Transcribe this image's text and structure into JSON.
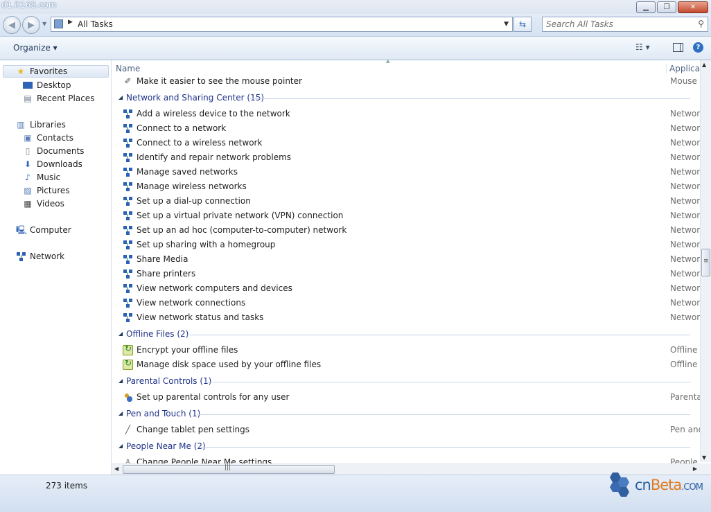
{
  "watermark": "d1.it168.com",
  "window_controls": {
    "minimize": "▁",
    "maximize": "❐",
    "close": "✕"
  },
  "address": {
    "path": "All Tasks"
  },
  "search": {
    "placeholder": "Search All Tasks"
  },
  "toolbar": {
    "organize": "Organize ▾",
    "views": "☷ ▾",
    "help": "?"
  },
  "nav": {
    "favorites": "Favorites",
    "desktop": "Desktop",
    "recent_places": "Recent Places",
    "libraries": "Libraries",
    "contacts": "Contacts",
    "documents": "Documents",
    "downloads": "Downloads",
    "music": "Music",
    "pictures": "Pictures",
    "videos": "Videos",
    "computer": "Computer",
    "network": "Network"
  },
  "columns": {
    "name": "Name",
    "application": "Application"
  },
  "list": {
    "mouse_item": {
      "title": "Make it easier to see the mouse pointer",
      "app": "Mouse"
    },
    "network_group": "Network and Sharing Center (15)",
    "network_items": [
      {
        "title": "Add a wireless device to the network",
        "app": "Network"
      },
      {
        "title": "Connect to a network",
        "app": "Network"
      },
      {
        "title": "Connect to a wireless network",
        "app": "Network"
      },
      {
        "title": "Identify and repair network problems",
        "app": "Network"
      },
      {
        "title": "Manage saved networks",
        "app": "Network"
      },
      {
        "title": "Manage wireless networks",
        "app": "Network"
      },
      {
        "title": "Set up a dial-up connection",
        "app": "Network"
      },
      {
        "title": "Set up a virtual private network (VPN) connection",
        "app": "Network"
      },
      {
        "title": "Set up an ad hoc (computer-to-computer) network",
        "app": "Network"
      },
      {
        "title": "Set up sharing with a homegroup",
        "app": "Network"
      },
      {
        "title": "Share Media",
        "app": "Network"
      },
      {
        "title": "Share printers",
        "app": "Network"
      },
      {
        "title": "View network computers and devices",
        "app": "Network"
      },
      {
        "title": "View network connections",
        "app": "Network"
      },
      {
        "title": "View network status and tasks",
        "app": "Network"
      }
    ],
    "offline_group": "Offline Files (2)",
    "offline_items": [
      {
        "title": "Encrypt your offline files",
        "app": "Offline Files"
      },
      {
        "title": "Manage disk space used by your offline files",
        "app": "Offline Files"
      }
    ],
    "parental_group": "Parental Controls (1)",
    "parental_items": [
      {
        "title": "Set up parental controls for any user",
        "app": "Parental Controls"
      }
    ],
    "pen_group": "Pen and Touch (1)",
    "pen_items": [
      {
        "title": "Change tablet pen settings",
        "app": "Pen and Touch"
      }
    ],
    "people_group": "People Near Me (2)",
    "people_items": [
      {
        "title": "Change People Near Me settings",
        "app": "People Near Me"
      }
    ]
  },
  "status": {
    "count": "273 items"
  },
  "logo": {
    "cn": "cn",
    "beta": "Beta",
    "com": ".COM"
  }
}
